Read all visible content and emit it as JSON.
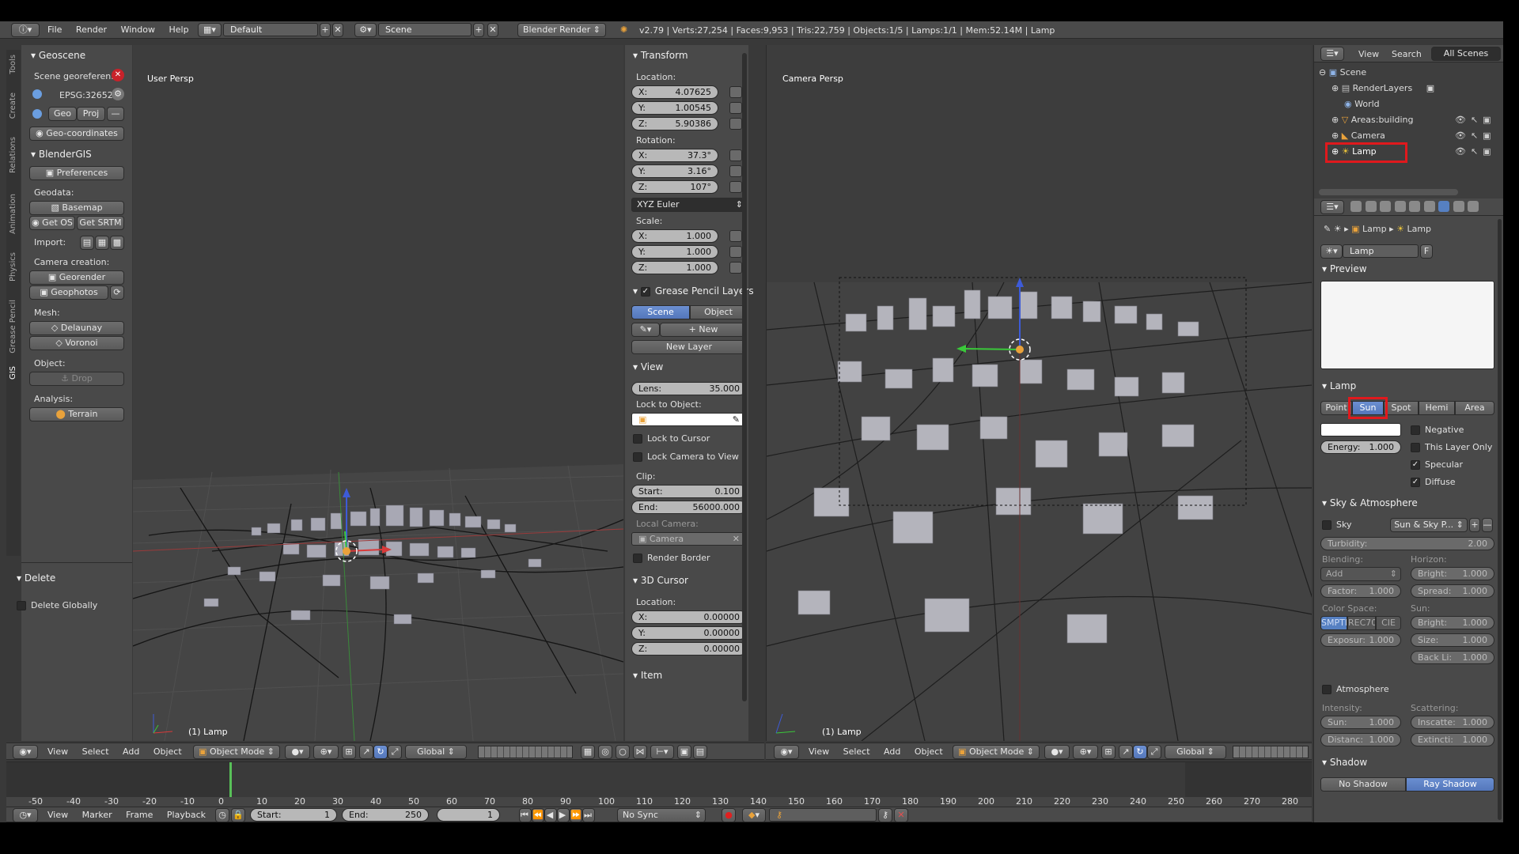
{
  "topbar": {
    "menus": [
      "File",
      "Render",
      "Window",
      "Help"
    ],
    "layout": "Default",
    "scene": "Scene",
    "engine": "Blender Render",
    "stats": "v2.79 | Verts:27,254 | Faces:9,953 | Tris:22,759 | Objects:1/5 | Lamps:1/1 | Mem:52.14M | Lamp"
  },
  "tool_tabs": [
    "Tools",
    "Create",
    "Relations",
    "Animation",
    "Physics",
    "Grease Pencil",
    "GIS"
  ],
  "toolshelf": {
    "geoscene_title": "Geoscene",
    "georef_label": "Scene georeferen...",
    "crs": "EPSG:32652",
    "geo_btn": "Geo",
    "proj_btn": "Proj",
    "geocoords_btn": "Geo-coordinates",
    "blendergis_title": "BlenderGIS",
    "preferences_btn": "Preferences",
    "geodata_label": "Geodata:",
    "basemap_btn": "Basemap",
    "getos_btn": "Get OS",
    "getsrtm_btn": "Get SRTM",
    "import_label": "Import:",
    "camera_creation_label": "Camera creation:",
    "georender_btn": "Georender",
    "geophotos_btn": "Geophotos",
    "mesh_label": "Mesh:",
    "delaunay_btn": "Delaunay",
    "voronoi_btn": "Voronoi",
    "object_label": "Object:",
    "drop_btn": "Drop",
    "analysis_label": "Analysis:",
    "terrain_btn": "Terrain",
    "delete_title": "Delete",
    "delete_globally": "Delete Globally"
  },
  "viewport_left": {
    "title": "User Persp",
    "object_label": "(1) Lamp"
  },
  "viewport_right": {
    "title": "Camera Persp",
    "object_label": "(1) Lamp"
  },
  "npanel": {
    "transform_title": "Transform",
    "location_label": "Location:",
    "loc": [
      {
        "k": "X:",
        "v": "4.07625"
      },
      {
        "k": "Y:",
        "v": "1.00545"
      },
      {
        "k": "Z:",
        "v": "5.90386"
      }
    ],
    "rotation_label": "Rotation:",
    "rot": [
      {
        "k": "X:",
        "v": "37.3°"
      },
      {
        "k": "Y:",
        "v": "3.16°"
      },
      {
        "k": "Z:",
        "v": "107°"
      }
    ],
    "rot_mode": "XYZ Euler",
    "scale_label": "Scale:",
    "scale": [
      {
        "k": "X:",
        "v": "1.000"
      },
      {
        "k": "Y:",
        "v": "1.000"
      },
      {
        "k": "Z:",
        "v": "1.000"
      }
    ],
    "gp_title": "Grease Pencil Layers",
    "gp_scene": "Scene",
    "gp_object": "Object",
    "gp_new": "New",
    "gp_new_layer": "New Layer",
    "view_title": "View",
    "lens_k": "Lens:",
    "lens_v": "35.000",
    "lock_obj_label": "Lock to Object:",
    "lock_cursor": "Lock to Cursor",
    "lock_cam": "Lock Camera to View",
    "clip_label": "Clip:",
    "clip_start_k": "Start:",
    "clip_start_v": "0.100",
    "clip_end_k": "End:",
    "clip_end_v": "56000.000",
    "local_cam_label": "Local Camera:",
    "local_cam": "Camera",
    "render_border": "Render Border",
    "cursor_title": "3D Cursor",
    "cursor_loc_label": "Location:",
    "cursor": [
      {
        "k": "X:",
        "v": "0.00000"
      },
      {
        "k": "Y:",
        "v": "0.00000"
      },
      {
        "k": "Z:",
        "v": "0.00000"
      }
    ],
    "item_title": "Item"
  },
  "outliner": {
    "view": "View",
    "search": "Search",
    "filter": "All Scenes",
    "items": [
      "Scene",
      "RenderLayers",
      "World",
      "Areas:building",
      "Camera",
      "Lamp"
    ]
  },
  "properties": {
    "breadcrumb_a": "Lamp",
    "breadcrumb_b": "Lamp",
    "datablock": "Lamp",
    "fake": "F",
    "preview_title": "Preview",
    "lamp_title": "Lamp",
    "types": [
      "Point",
      "Sun",
      "Spot",
      "Hemi",
      "Area"
    ],
    "negative": "Negative",
    "this_layer": "This Layer Only",
    "specular": "Specular",
    "diffuse": "Diffuse",
    "energy_k": "Energy:",
    "energy_v": "1.000",
    "sky_title": "Sky & Atmosphere",
    "sky": "Sky",
    "sky_preset": "Sun & Sky P...",
    "turbidity_k": "Turbidity:",
    "turbidity_v": "2.00",
    "blending_label": "Blending:",
    "horizon_label": "Horizon:",
    "blend_mode": "Add",
    "bright_k": "Bright:",
    "bright_v": "1.000",
    "factor_k": "Factor:",
    "factor_v": "1.000",
    "spread_k": "Spread:",
    "spread_v": "1.000",
    "colorspace_label": "Color Space:",
    "sun_label": "Sun:",
    "cs": [
      "SMPTE",
      "REC70",
      "CIE"
    ],
    "sun_bright_k": "Bright:",
    "sun_bright_v": "1.000",
    "exposure_k": "Exposur:",
    "exposure_v": "1.000",
    "size_k": "Size:",
    "size_v": "1.000",
    "backli_k": "Back Li:",
    "backli_v": "1.000",
    "atmosphere": "Atmosphere",
    "intensity_label": "Intensity:",
    "scattering_label": "Scattering:",
    "int_sun_k": "Sun:",
    "int_sun_v": "1.000",
    "inscatt_k": "Inscatte:",
    "inscatt_v": "1.000",
    "distanc_k": "Distanc:",
    "distanc_v": "1.000",
    "extincti_k": "Extincti:",
    "extincti_v": "1.000",
    "shadow_title": "Shadow",
    "no_shadow": "No Shadow",
    "ray_shadow": "Ray Shadow"
  },
  "view3d_header": {
    "menus": [
      "View",
      "Select",
      "Add",
      "Object"
    ],
    "mode": "Object Mode",
    "orient": "Global"
  },
  "timeline": {
    "ticks": [
      "-50",
      "-40",
      "-30",
      "-20",
      "-10",
      "0",
      "10",
      "20",
      "30",
      "40",
      "50",
      "60",
      "70",
      "80",
      "90",
      "100",
      "110",
      "120",
      "130",
      "140",
      "150",
      "160",
      "170",
      "180",
      "190",
      "200",
      "210",
      "220",
      "230",
      "240",
      "250",
      "260",
      "270",
      "280"
    ],
    "menus": [
      "View",
      "Marker",
      "Frame",
      "Playback"
    ],
    "start_k": "Start:",
    "start_v": "1",
    "end_k": "End:",
    "end_v": "250",
    "current": "1",
    "sync": "No Sync"
  },
  "colors": {
    "accent": "#5680c2",
    "highlight": "#e0191d"
  }
}
